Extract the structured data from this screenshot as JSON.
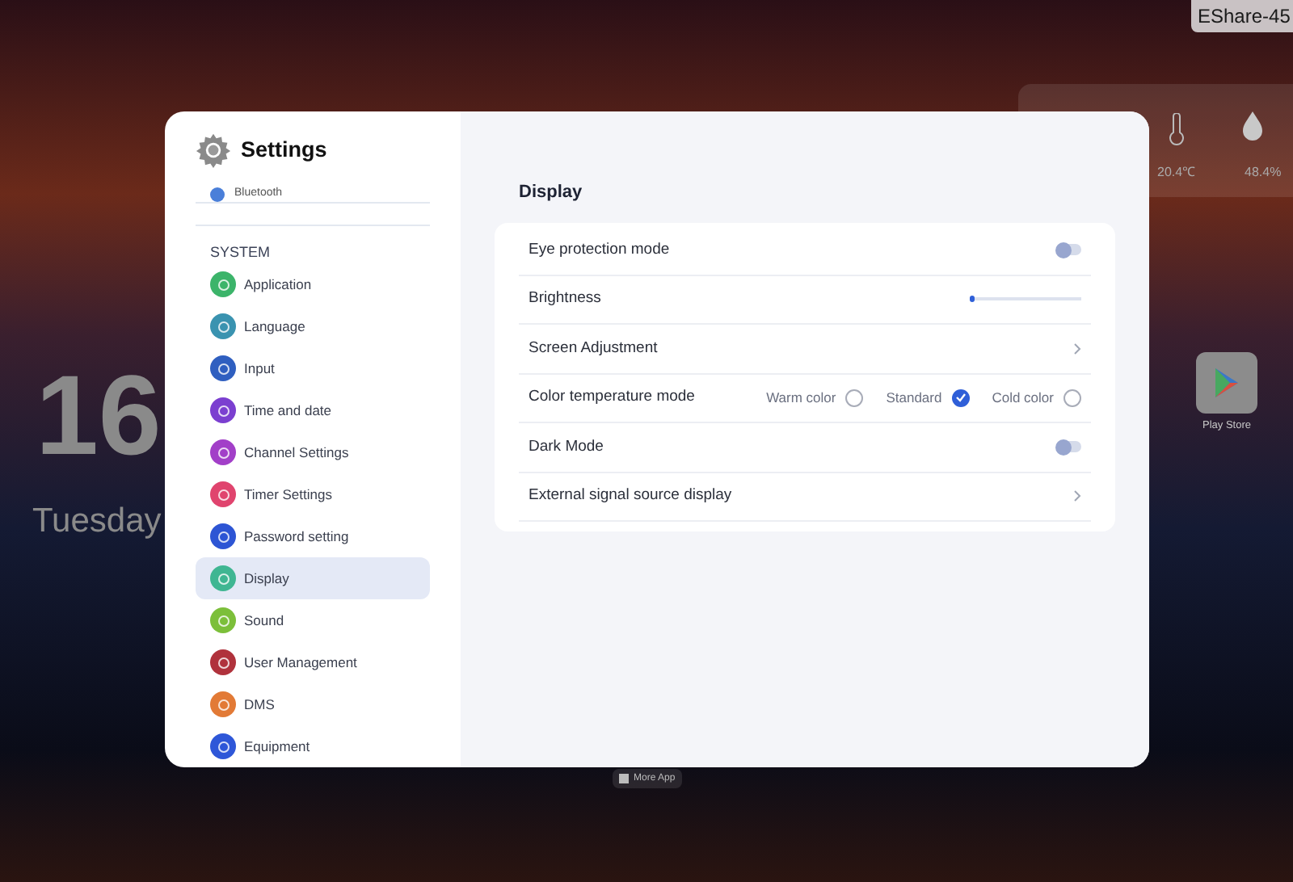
{
  "desktop": {
    "device_name": "EShare-45",
    "temperature": "20.4℃",
    "humidity": "48.4%",
    "clock_hour": "16",
    "weekday": "Tuesday",
    "apps": [
      {
        "label": "Play Store"
      }
    ],
    "more_apps": "More App"
  },
  "settings": {
    "title": "Settings",
    "sidebar": {
      "partial_item": {
        "label": "Bluetooth",
        "color": "#4a7fd9"
      },
      "section": "SYSTEM",
      "items": [
        {
          "label": "Application",
          "color": "#3cb46a",
          "selected": false
        },
        {
          "label": "Language",
          "color": "#3a93b0",
          "selected": false
        },
        {
          "label": "Input",
          "color": "#2f5fc0",
          "selected": false
        },
        {
          "label": "Time and date",
          "color": "#7b3fd0",
          "selected": false
        },
        {
          "label": "Channel Settings",
          "color": "#a23fc8",
          "selected": false
        },
        {
          "label": "Timer Settings",
          "color": "#e0446e",
          "selected": false
        },
        {
          "label": "Password setting",
          "color": "#2d55d4",
          "selected": false
        },
        {
          "label": "Display",
          "color": "#3fb692",
          "selected": true
        },
        {
          "label": "Sound",
          "color": "#7cbf3a",
          "selected": false
        },
        {
          "label": "User Management",
          "color": "#b0323c",
          "selected": false
        },
        {
          "label": "DMS",
          "color": "#e27a36",
          "selected": false
        },
        {
          "label": "Equipment",
          "color": "#2e57d8",
          "selected": false
        }
      ]
    },
    "page_title": "Display",
    "rows": [
      {
        "kind": "toggle",
        "label": "Eye protection mode",
        "on": false
      },
      {
        "kind": "slider",
        "label": "Brightness",
        "level": 0.05
      },
      {
        "kind": "link",
        "label": "Screen Adjustment"
      },
      {
        "kind": "radio",
        "label": "Color temperature mode",
        "options": [
          {
            "label": "Warm color",
            "selected": false
          },
          {
            "label": "Standard",
            "selected": true
          },
          {
            "label": "Cold color",
            "selected": false
          }
        ]
      },
      {
        "kind": "toggle",
        "label": "Dark Mode",
        "on": false
      },
      {
        "kind": "link",
        "label": "External signal source display"
      }
    ]
  }
}
